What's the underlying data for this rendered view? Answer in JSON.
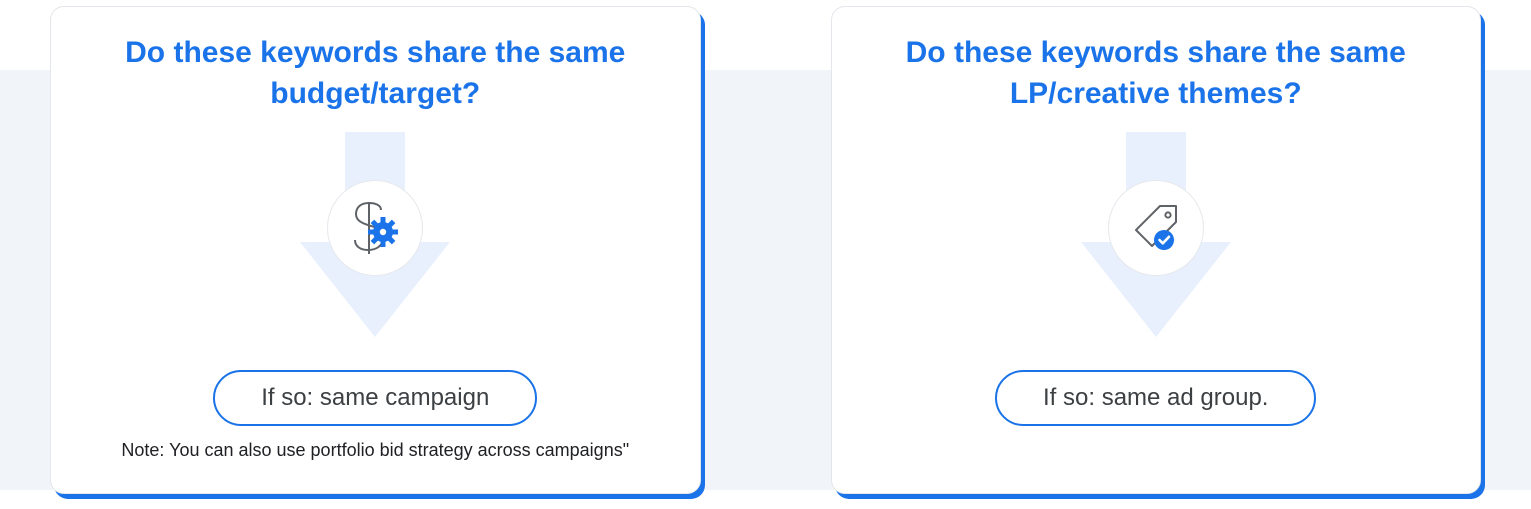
{
  "cards": [
    {
      "title": "Do these keywords share the same budget/target?",
      "pill": "If so: same campaign",
      "note": "Note: You can also use portfolio bid strategy across campaigns\"",
      "icon": "dollar-gear-icon"
    },
    {
      "title": "Do these keywords share the same LP/creative themes?",
      "pill": "If so: same ad group.",
      "note": "",
      "icon": "tag-check-icon"
    }
  ],
  "colors": {
    "accent": "#1a73e8",
    "arrowFill": "#e8f0fe"
  }
}
